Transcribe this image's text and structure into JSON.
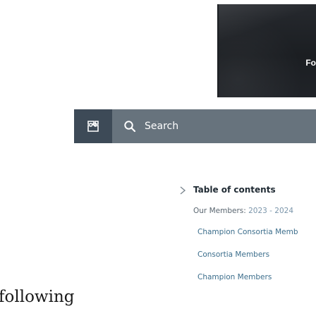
{
  "hero": {
    "tag_fragment": "Fo"
  },
  "search": {
    "placeholder": "Search"
  },
  "toc": {
    "title": "Table of contents",
    "items": [
      {
        "label": "Our Members: ",
        "suffix": "2023 - 2024"
      },
      {
        "label": "Champion Consortia Memb"
      },
      {
        "label": "Consortia Members"
      },
      {
        "label": "Champion Members"
      }
    ]
  },
  "body": {
    "heading_fragment": "following"
  },
  "colors": {
    "search_left_bg": "#3d4a57",
    "search_box_bg": "#67737d",
    "link": "#3c6e8c"
  }
}
